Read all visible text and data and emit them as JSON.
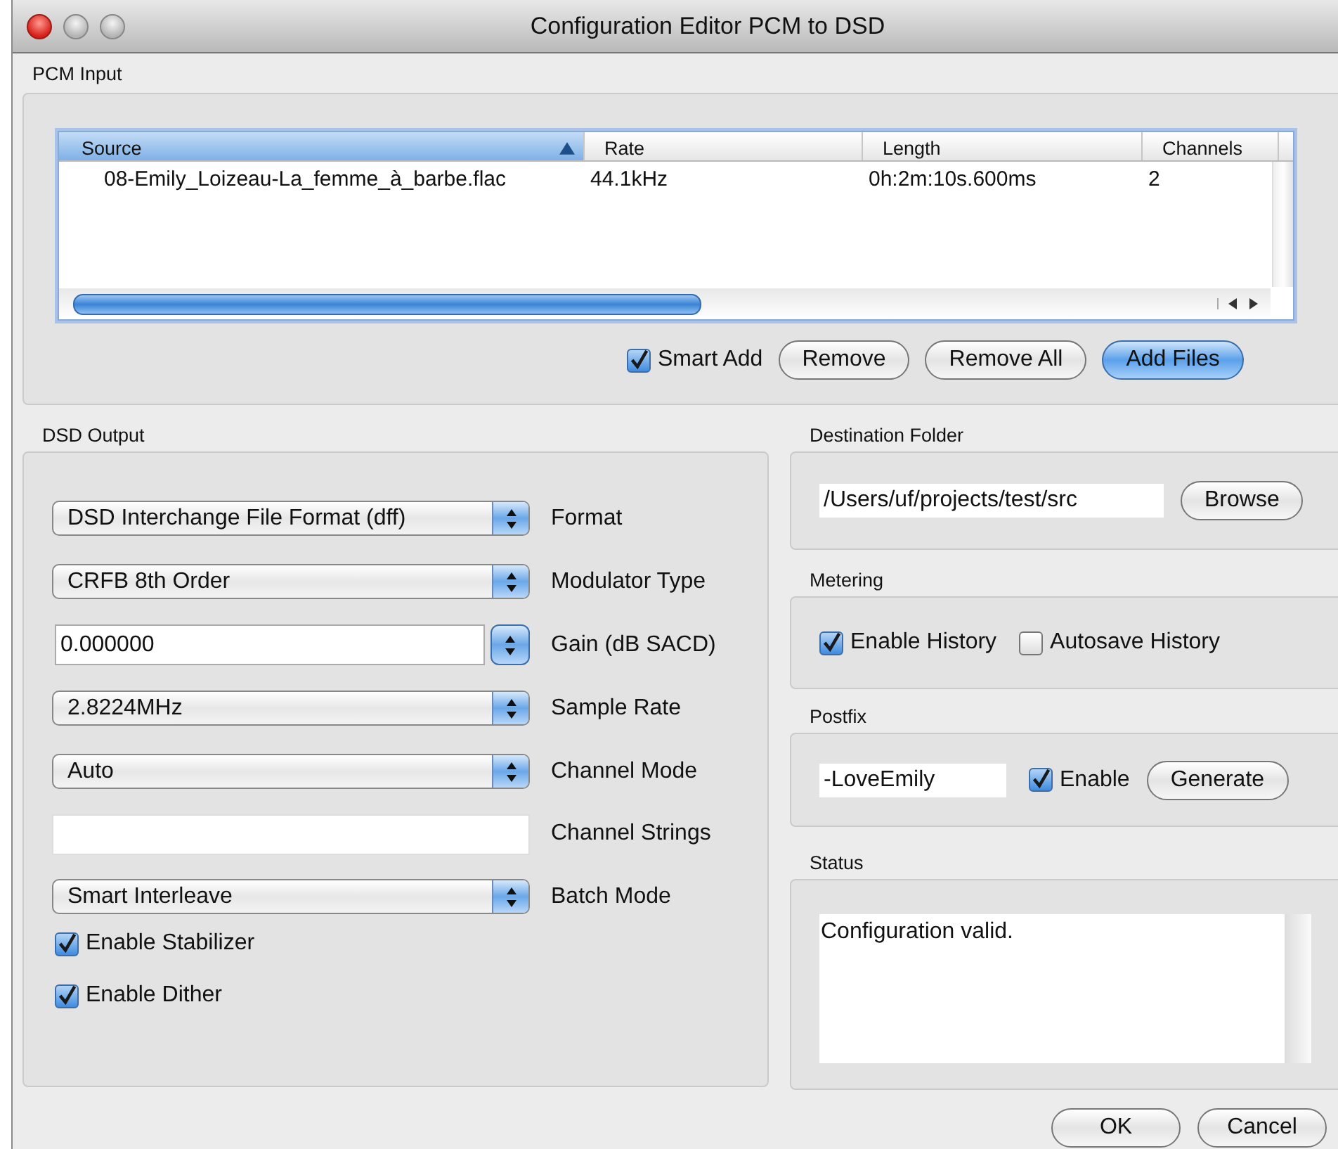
{
  "window": {
    "title": "Configuration Editor PCM to DSD"
  },
  "pcm_input": {
    "title": "PCM Input",
    "table": {
      "columns": [
        {
          "label": "Source",
          "sorted": true
        },
        {
          "label": "Rate",
          "sorted": false
        },
        {
          "label": "Length",
          "sorted": false
        },
        {
          "label": "Channels",
          "sorted": false
        }
      ],
      "rows": [
        [
          "08-Emily_Loizeau-La_femme_à_barbe.flac",
          "44.1kHz",
          "0h:2m:10s.600ms",
          "2"
        ]
      ]
    },
    "smart_add": {
      "label": "Smart Add",
      "checked": true
    },
    "buttons": [
      {
        "label": "Remove",
        "default": false
      },
      {
        "label": "Remove All",
        "default": false
      },
      {
        "label": "Add Files",
        "default": true
      }
    ]
  },
  "dsd_output": {
    "title": "DSD Output",
    "rows": [
      {
        "kind": "popup",
        "value": "DSD Interchange File Format (dff)",
        "label": "Format"
      },
      {
        "kind": "popup",
        "value": "CRFB 8th Order",
        "label": "Modulator Type"
      },
      {
        "kind": "stepper",
        "value": "0.000000",
        "label": "Gain (dB SACD)"
      },
      {
        "kind": "popup",
        "value": "2.8224MHz",
        "label": "Sample Rate"
      },
      {
        "kind": "popup",
        "value": "Auto",
        "label": "Channel Mode"
      },
      {
        "kind": "text",
        "label": "Channel Strings"
      },
      {
        "kind": "popup",
        "value": "Smart Interleave",
        "label": "Batch Mode"
      }
    ],
    "checkboxes": [
      {
        "label": "Enable Stabilizer",
        "checked": true
      },
      {
        "label": "Enable Dither",
        "checked": true
      }
    ]
  },
  "destination_folder": {
    "title": "Destination Folder",
    "value": "/Users/uf/projects/test/src",
    "button": "Browse"
  },
  "metering": {
    "title": "Metering",
    "checkboxes": [
      {
        "label": "Enable History",
        "checked": true
      },
      {
        "label": "Autosave History",
        "checked": false
      }
    ]
  },
  "postfix": {
    "title": "Postfix",
    "value": "-LoveEmily",
    "enable": {
      "label": "Enable",
      "checked": true
    },
    "button": "Generate"
  },
  "status": {
    "title": "Status",
    "text": "Configuration valid."
  },
  "buttons": [
    {
      "label": "OK"
    },
    {
      "label": "Cancel"
    }
  ]
}
